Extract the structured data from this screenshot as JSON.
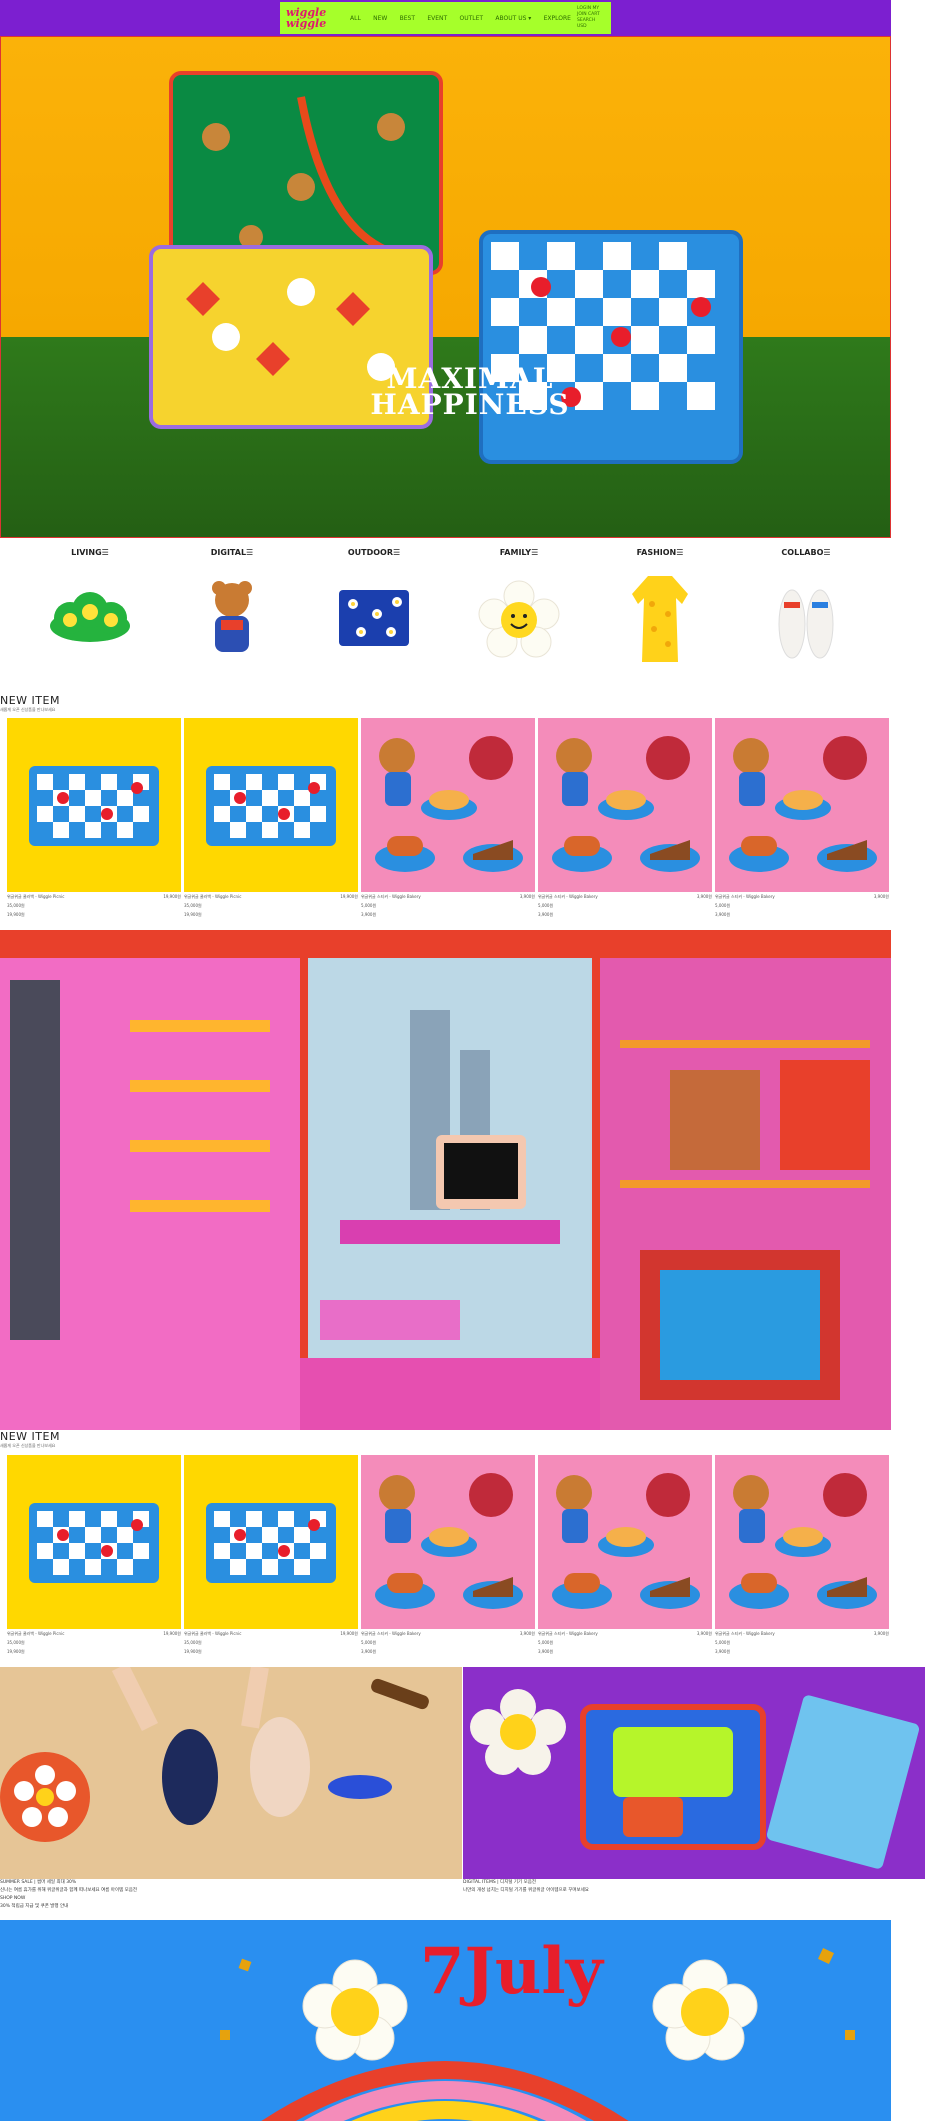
{
  "header": {
    "logo": "wiggle wiggle",
    "menu": [
      "ALL",
      "NEW",
      "BEST",
      "EVENT",
      "OUTLET",
      "ABOUT US ▾",
      "EXPLORE"
    ],
    "util": [
      "LOGIN  MY",
      "JOIN CART",
      "SEARCH",
      "USD"
    ]
  },
  "hero": {
    "title_line1": "MAXIMAL",
    "title_line2": "HAPPINESS"
  },
  "categories": [
    {
      "label": "LIVING☰",
      "icon": "cloud-cushion-icon"
    },
    {
      "label": "DIGITAL☰",
      "icon": "bear-doll-icon"
    },
    {
      "label": "OUTDOOR☰",
      "icon": "flower-pouch-icon"
    },
    {
      "label": "FAMILY☰",
      "icon": "smile-flower-icon"
    },
    {
      "label": "FASHION☰",
      "icon": "yellow-robe-icon"
    },
    {
      "label": "COLLABO☰",
      "icon": "slippers-icon"
    }
  ],
  "new_item_1": {
    "title": "NEW ITEM",
    "subtitle": "새롭게 오픈 신상품을 만나보세요",
    "products": [
      {
        "name": "위글위글 쿨러백 - Wiggle Picnic",
        "price": "19,900원",
        "line2": "35,000원",
        "line3": "19,900원"
      },
      {
        "name": "위글위글 쿨러백 - Wiggle Picnic",
        "price": "19,900원",
        "line2": "35,000원",
        "line3": "19,900원"
      },
      {
        "name": "위글위글 스티커 - Wiggle Bakery",
        "price": "3,900원",
        "line2": "5,000원",
        "line3": "3,900원"
      },
      {
        "name": "위글위글 스티커 - Wiggle Bakery",
        "price": "3,900원",
        "line2": "5,000원",
        "line3": "3,900원"
      },
      {
        "name": "위글위글 스티커 - Wiggle Bakery",
        "price": "3,900원",
        "line2": "5,000원",
        "line3": "3,900원"
      }
    ]
  },
  "new_item_2": {
    "title": "NEW ITEM",
    "subtitle": "새롭게 오픈 신상품을 만나보세요",
    "products": [
      {
        "name": "위글위글 쿨러백 - Wiggle Picnic",
        "price": "19,900원",
        "line2": "35,000원",
        "line3": "19,900원"
      },
      {
        "name": "위글위글 쿨러백 - Wiggle Picnic",
        "price": "19,900원",
        "line2": "35,000원",
        "line3": "19,900원"
      },
      {
        "name": "위글위글 스티커 - Wiggle Bakery",
        "price": "3,900원",
        "line2": "5,000원",
        "line3": "3,900원"
      },
      {
        "name": "위글위글 스티커 - Wiggle Bakery",
        "price": "3,900원",
        "line2": "5,000원",
        "line3": "3,900원"
      },
      {
        "name": "위글위글 스티커 - Wiggle Bakery",
        "price": "3,900원",
        "line2": "5,000원",
        "line3": "3,900원"
      }
    ]
  },
  "promos": [
    {
      "line1": "SUMMER SALE | 썸머 세일 최대 30%",
      "line2": "신나는 여름 휴가를 위해 위글위글과 함께 떠나보세요 여름 아이템 모음전",
      "line3": "SHOP NOW",
      "line4": "30% 적립금 지급 및 쿠폰 발행 안내"
    },
    {
      "line1": "DIGITAL ITEMS | 디지털 기기 모음전",
      "line2": "나만의 개성 넘치는 디지털 기기를 위글위글 아이템으로 꾸며보세요",
      "line3": "",
      "line4": ""
    }
  ],
  "july": {
    "text": "7July"
  },
  "colors": {
    "header": "#7c1fd0",
    "nav": "#a6ff2a",
    "hero": "#fbb209",
    "yellow_tile": "#ffd800",
    "pink_tile": "#f48cba",
    "july_bg": "#2a8ff0"
  }
}
